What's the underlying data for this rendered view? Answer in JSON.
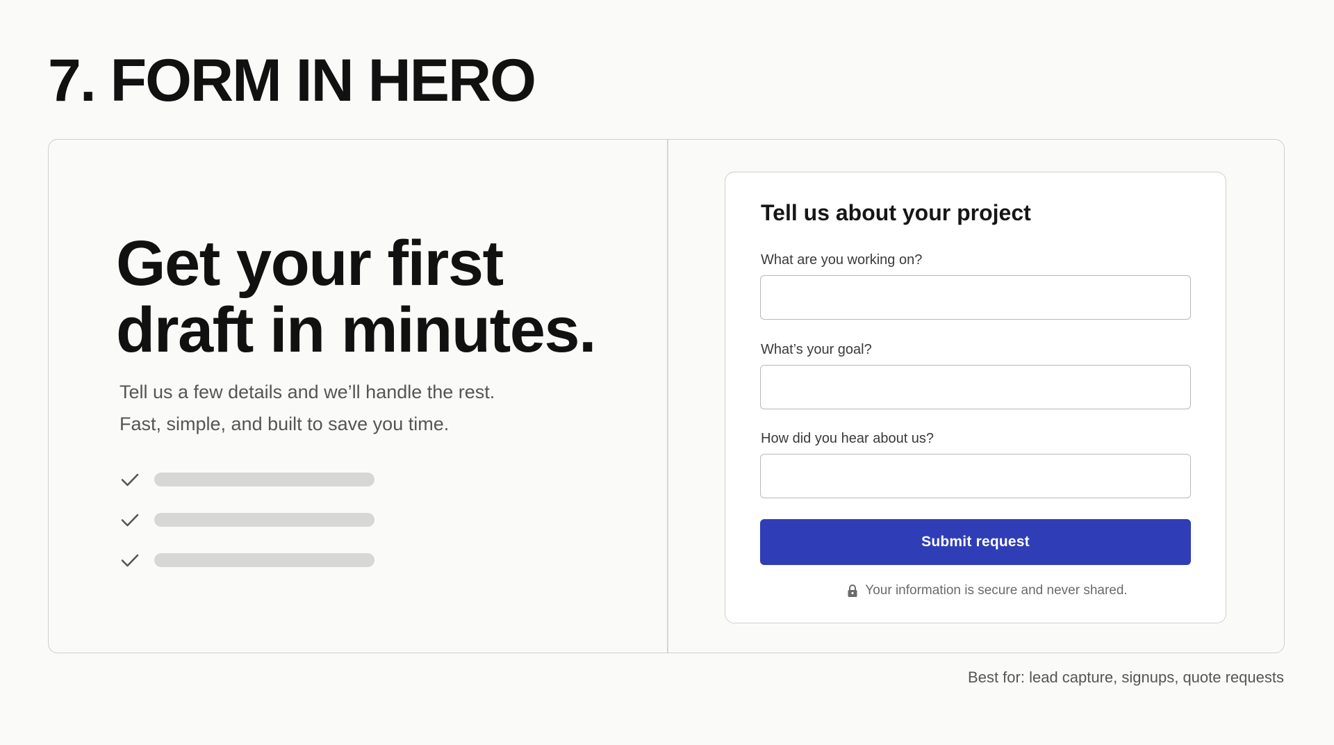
{
  "section": {
    "title": "7. FORM IN HERO"
  },
  "hero": {
    "headline_line1": "Get your first",
    "headline_line2": "draft in minutes.",
    "subtext_line1": "Tell us a few details and we’ll handle the rest.",
    "subtext_line2": "Fast, simple, and built to save you time.",
    "checklist_icons": [
      "check-icon",
      "check-icon",
      "check-icon"
    ]
  },
  "form": {
    "title": "Tell us about your project",
    "fields": [
      {
        "label": "What are you working on?",
        "value": "",
        "placeholder": ""
      },
      {
        "label": "What’s your goal?",
        "value": "",
        "placeholder": ""
      },
      {
        "label": "How did you hear about us?",
        "value": "",
        "placeholder": ""
      }
    ],
    "submit_label": "Submit request",
    "secure_icon": "lock-icon",
    "secure_note": "Your information is secure and never shared."
  },
  "footer": {
    "best_for": "Best for: lead capture, signups, quote requests"
  },
  "colors": {
    "background": "#fafaf8",
    "accent": "#2f3db7",
    "placeholder_bar": "#d7d7d5"
  }
}
